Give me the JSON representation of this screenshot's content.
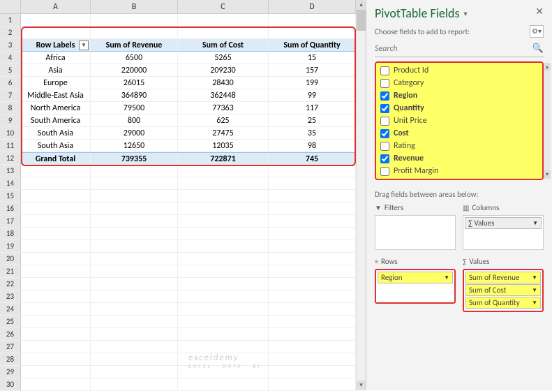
{
  "columns": [
    "A",
    "B",
    "C",
    "D"
  ],
  "row_numbers": [
    1,
    2,
    3,
    4,
    5,
    6,
    7,
    8,
    9,
    10,
    11,
    12,
    13,
    14,
    15,
    16,
    17,
    18,
    19,
    20,
    21,
    22,
    23,
    24,
    25,
    26,
    27,
    28,
    29,
    30
  ],
  "pivot": {
    "headers": [
      "Row Labels",
      "Sum of Revenue",
      "Sum of Cost",
      "Sum of Quantity"
    ],
    "rows": [
      {
        "label": "Africa",
        "rev": "6500",
        "cost": "5265",
        "qty": "15"
      },
      {
        "label": "Asia",
        "rev": "220000",
        "cost": "209230",
        "qty": "157"
      },
      {
        "label": "Europe",
        "rev": "26015",
        "cost": "28430",
        "qty": "199"
      },
      {
        "label": "Middle-East Asia",
        "rev": "364890",
        "cost": "362448",
        "qty": "99"
      },
      {
        "label": "North America",
        "rev": "79500",
        "cost": "77363",
        "qty": "117"
      },
      {
        "label": "South America",
        "rev": "800",
        "cost": "625",
        "qty": "25"
      },
      {
        "label": "South Asia",
        "rev": "29000",
        "cost": "27475",
        "qty": "35"
      },
      {
        "label": "South Asia",
        "rev": "12650",
        "cost": "12035",
        "qty": "98"
      }
    ],
    "total": {
      "label": "Grand Total",
      "rev": "739355",
      "cost": "722871",
      "qty": "745"
    }
  },
  "pane": {
    "title": "PivotTable Fields",
    "subtitle": "Choose fields to add to report:",
    "search_placeholder": "Search",
    "fields": [
      {
        "name": "Product Id",
        "checked": false
      },
      {
        "name": "Category",
        "checked": false
      },
      {
        "name": "Region",
        "checked": true
      },
      {
        "name": "Quantity",
        "checked": true
      },
      {
        "name": "Unit Price",
        "checked": false
      },
      {
        "name": "Cost",
        "checked": true
      },
      {
        "name": "Rating",
        "checked": false
      },
      {
        "name": "Revenue",
        "checked": true
      },
      {
        "name": "Profit Margin",
        "checked": false
      }
    ],
    "drag_label": "Drag fields between areas below:",
    "areas": {
      "filters": {
        "title": "Filters",
        "items": []
      },
      "columns": {
        "title": "Columns",
        "items": [
          "Values"
        ]
      },
      "rows": {
        "title": "Rows",
        "items": [
          "Region"
        ]
      },
      "values": {
        "title": "Values",
        "items": [
          "Sum of Revenue",
          "Sum of Cost",
          "Sum of Quantity"
        ]
      }
    }
  },
  "watermark": {
    "main": "exceldemy",
    "sub": "EXCEL · DATA · BI"
  }
}
